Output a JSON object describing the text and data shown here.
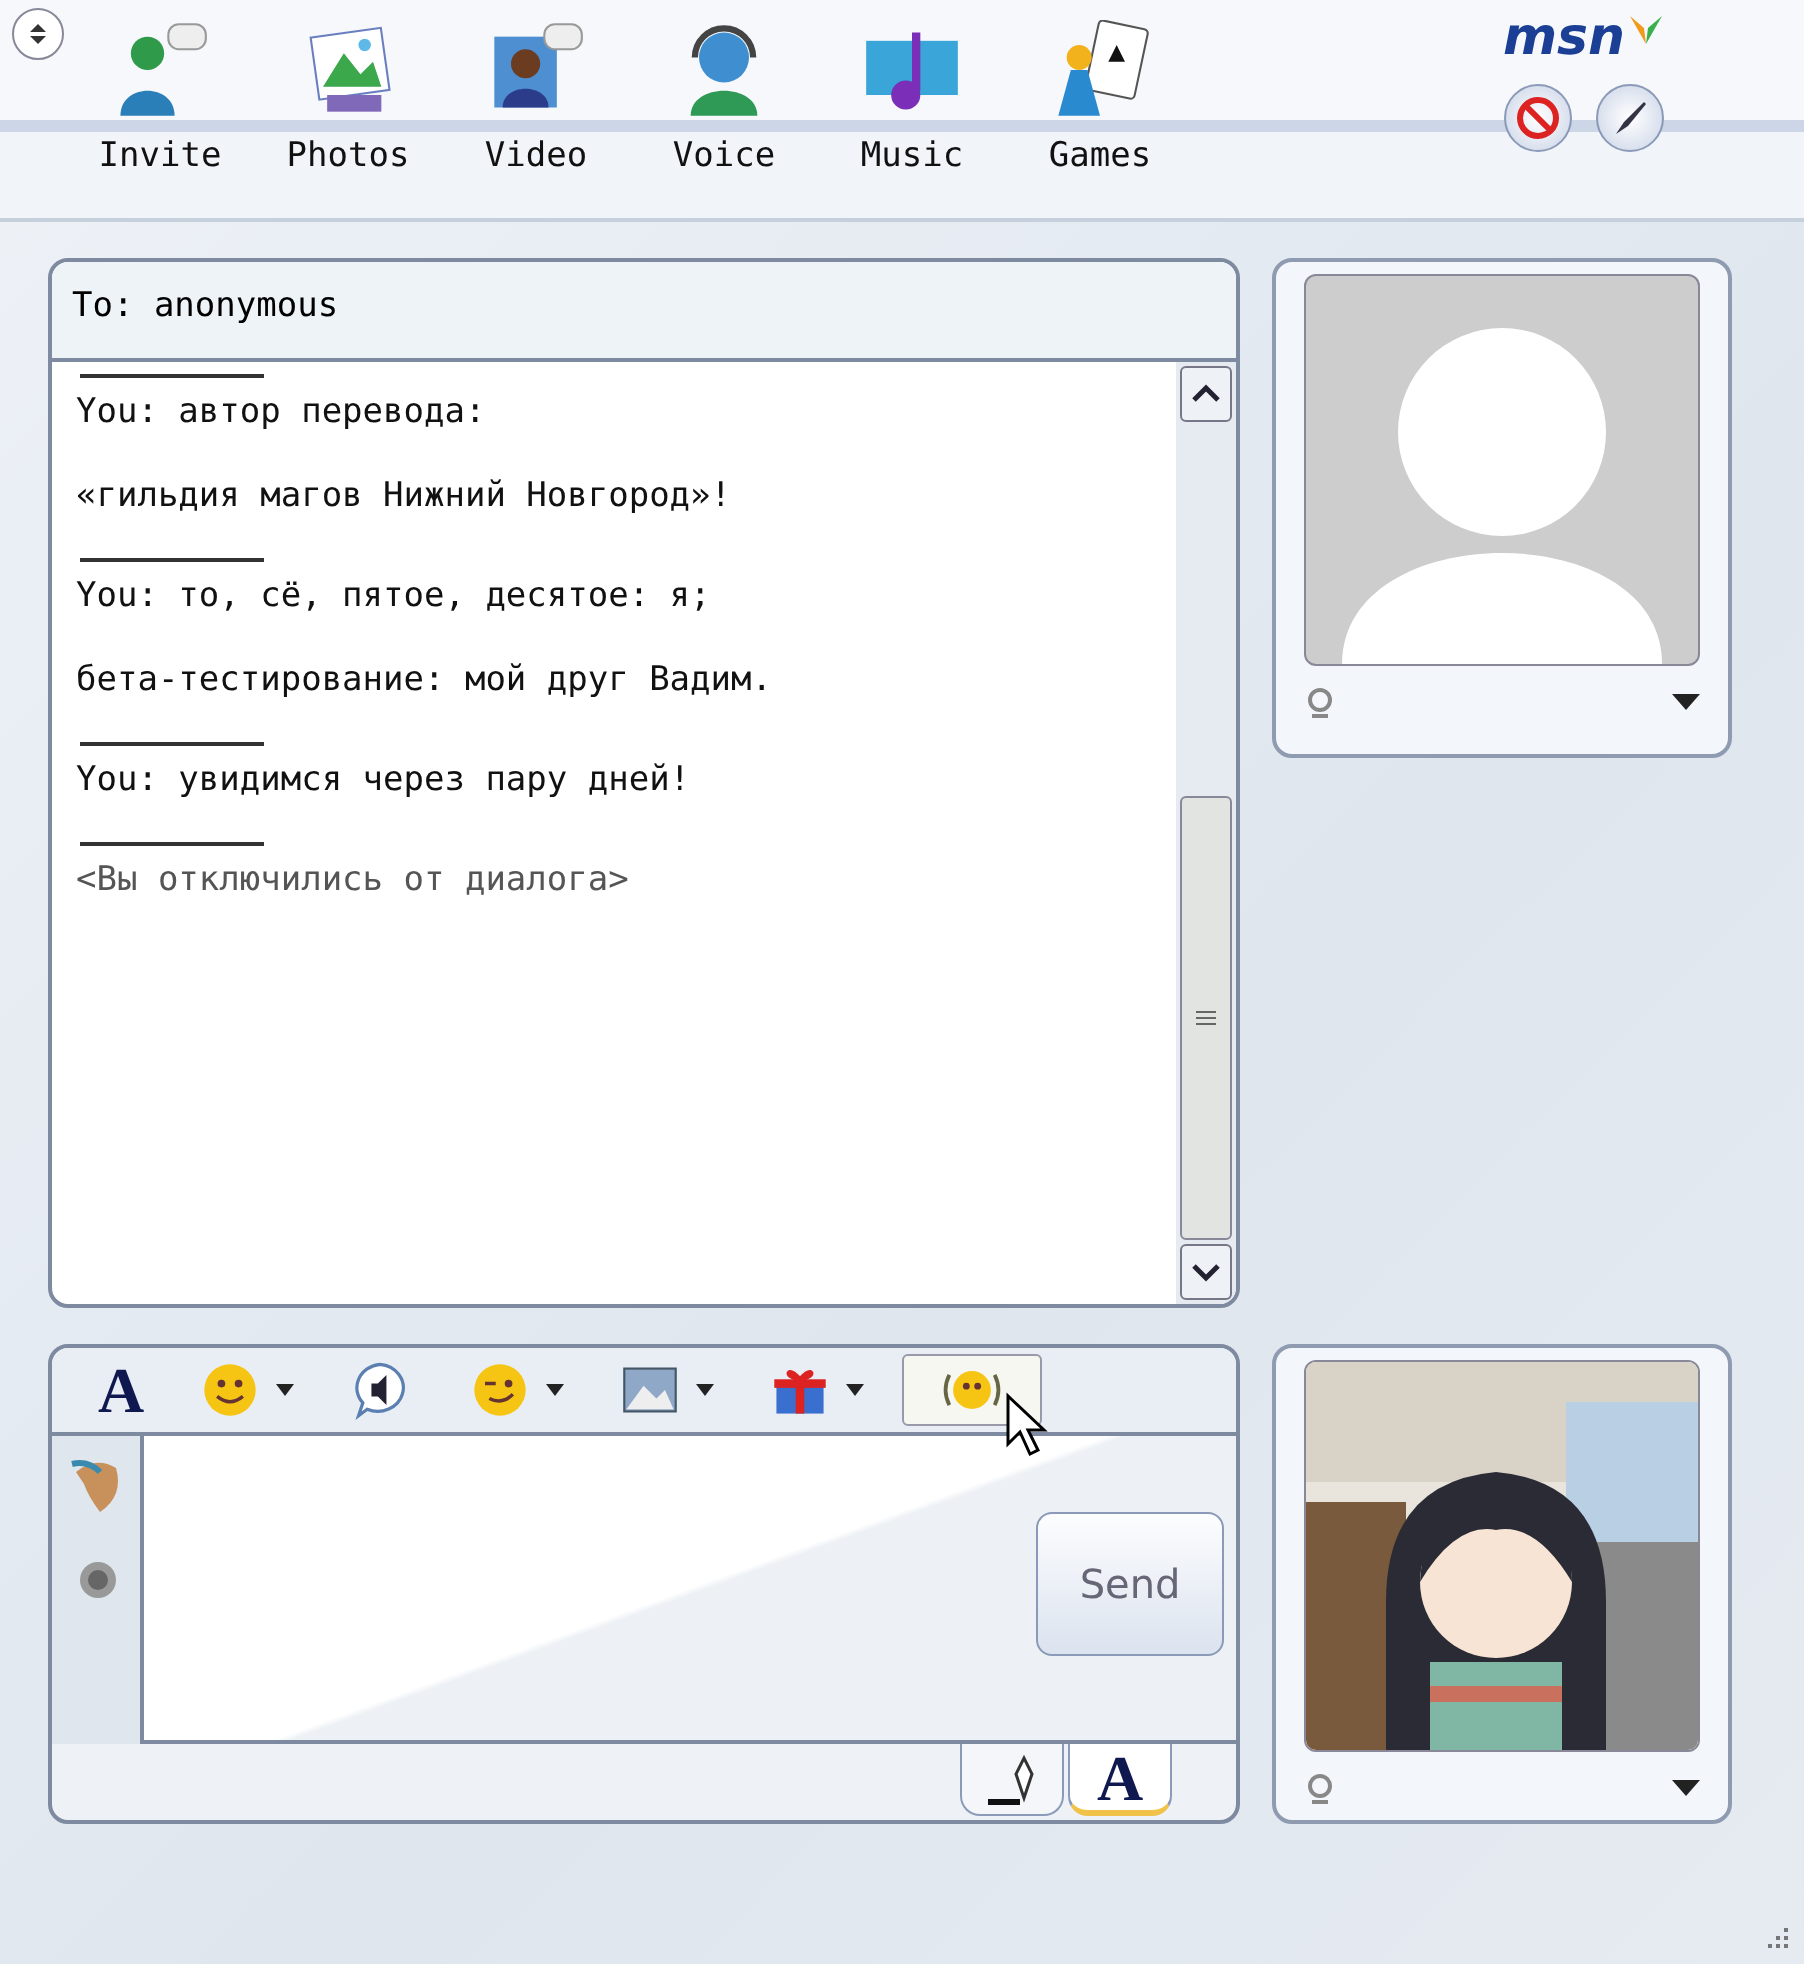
{
  "toolbar": {
    "items": [
      {
        "kind": "invite",
        "label": "Invite"
      },
      {
        "kind": "photos",
        "label": "Photos"
      },
      {
        "kind": "video",
        "label": "Video"
      },
      {
        "kind": "voice",
        "label": "Voice"
      },
      {
        "kind": "music",
        "label": "Music"
      },
      {
        "kind": "games",
        "label": "Games"
      }
    ],
    "logo": "msn",
    "actions": [
      {
        "kind": "block"
      },
      {
        "kind": "paint"
      }
    ]
  },
  "conversation": {
    "to": "To: anonymous",
    "messages": [
      {
        "lines": [
          "You: автор перевода:",
          "«гильдия магов Нижний Новгород»!"
        ]
      },
      {
        "lines": [
          "You: то, сё, пятое, десятое: я;",
          "бета-тестирование: мой друг Вадим."
        ]
      },
      {
        "lines": [
          "You: увидимся через пару дней!"
        ]
      }
    ],
    "status": "<Вы отключились от диалога>"
  },
  "compose": {
    "tools": [
      {
        "kind": "font",
        "label": "A",
        "dropdown": false,
        "pressed": false
      },
      {
        "kind": "emoticon",
        "dropdown": true,
        "pressed": false
      },
      {
        "kind": "voice-clip",
        "dropdown": false,
        "pressed": false
      },
      {
        "kind": "wink",
        "dropdown": true,
        "pressed": false
      },
      {
        "kind": "background",
        "dropdown": true,
        "pressed": false
      },
      {
        "kind": "gift",
        "dropdown": true,
        "pressed": false
      },
      {
        "kind": "nudge",
        "dropdown": false,
        "pressed": true
      }
    ],
    "send": "Send",
    "tabs": [
      {
        "kind": "handwriting",
        "selected": false
      },
      {
        "kind": "text",
        "label": "A",
        "selected": true
      }
    ]
  },
  "contact_picture": {
    "kind": "avatar"
  }
}
